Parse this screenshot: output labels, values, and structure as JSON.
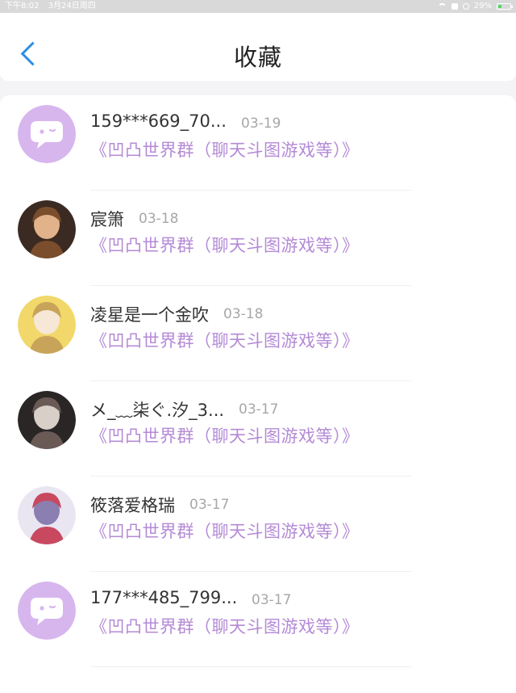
{
  "status_bar": {
    "time": "下午8:02",
    "date": "3月24日周四",
    "battery": "29%",
    "battery_level": 0.29,
    "icons": [
      "wifi-icon",
      "lock-icon",
      "alarm-icon",
      "battery-icon"
    ]
  },
  "header": {
    "back_icon": "chevron-left-icon",
    "title": "收藏"
  },
  "colors": {
    "accent_blue": "#2d8fe6",
    "group_purple": "#b48ad6",
    "avatar_purple": "#d7b6ee"
  },
  "items": [
    {
      "name": "159***669_70...",
      "date": "03-19",
      "group": "《凹凸世界群（聊天斗图游戏等）》",
      "avatar": "chat-bubble-avatar"
    },
    {
      "name": "宸箫",
      "date": "03-18",
      "group": "《凹凸世界群（聊天斗图游戏等）》",
      "avatar": "photo-avatar"
    },
    {
      "name": "凌星是一个金吹",
      "date": "03-18",
      "group": "《凹凸世界群（聊天斗图游戏等）》",
      "avatar": "photo-avatar"
    },
    {
      "name": "メ_﹏柒ぐ.汐_3...",
      "date": "03-17",
      "group": "《凹凸世界群（聊天斗图游戏等）》",
      "avatar": "photo-avatar"
    },
    {
      "name": "筱落爱格瑞",
      "date": "03-17",
      "group": "《凹凸世界群（聊天斗图游戏等）》",
      "avatar": "photo-avatar"
    },
    {
      "name": "177***485_799...",
      "date": "03-17",
      "group": "《凹凸世界群（聊天斗图游戏等）》",
      "avatar": "chat-bubble-avatar"
    }
  ]
}
